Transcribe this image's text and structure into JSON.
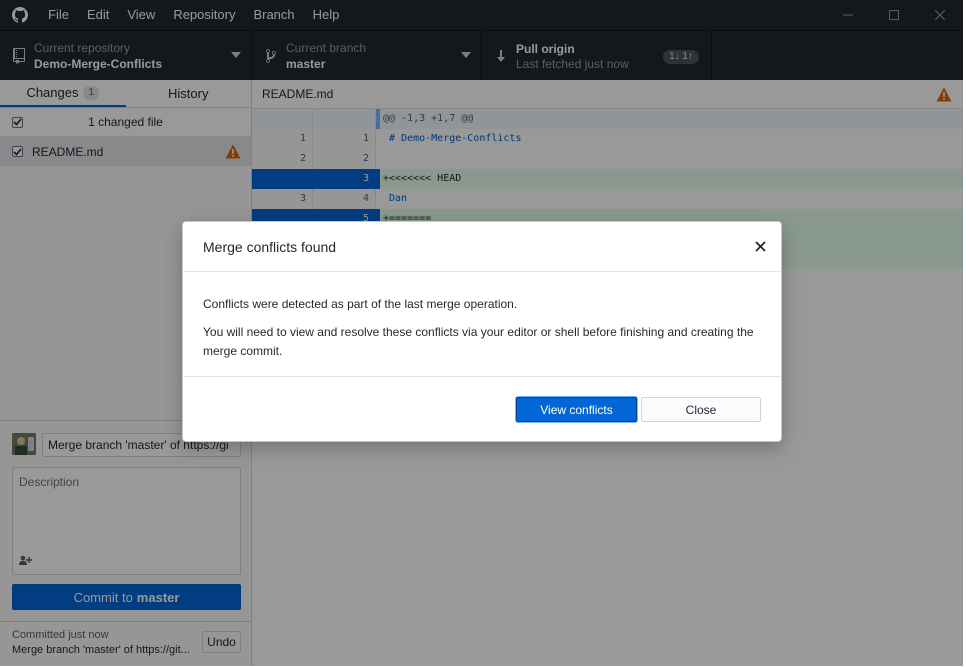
{
  "menu": {
    "items": [
      "File",
      "Edit",
      "View",
      "Repository",
      "Branch",
      "Help"
    ]
  },
  "toolbar": {
    "repository": {
      "label": "Current repository",
      "value": "Demo-Merge-Conflicts",
      "icon": "repo-icon"
    },
    "branch": {
      "label": "Current branch",
      "value": "master",
      "icon": "branch-icon"
    },
    "pull": {
      "label": "Pull origin",
      "value": "Last fetched just now",
      "icon": "arrow-down-icon",
      "badge": "1↓ 1↑"
    }
  },
  "sidebar": {
    "tabs": [
      {
        "label": "Changes",
        "count": "1",
        "active": true
      },
      {
        "label": "History",
        "active": false
      }
    ],
    "changed_header": "1 changed file",
    "files": [
      {
        "name": "README.md",
        "status": "conflicted"
      }
    ]
  },
  "commit": {
    "summary_value": "Merge branch 'master' of https://gi",
    "description_placeholder": "Description",
    "button_prefix": "Commit to",
    "button_branch": "master",
    "last_commit_label": "Committed just now",
    "last_commit_message": "Merge branch 'master' of https://git...",
    "undo_label": "Undo"
  },
  "diff": {
    "file_name": "README.md",
    "lines": [
      {
        "type": "hunk",
        "old": "",
        "new": "",
        "text": "@@ -1,3 +1,7 @@"
      },
      {
        "type": "context",
        "old": "1",
        "new": "1",
        "text": " # Demo-Merge-Conflicts"
      },
      {
        "type": "context",
        "old": "2",
        "new": "2",
        "text": ""
      },
      {
        "type": "add",
        "old": "",
        "new": "3",
        "text": "+<<<<<<< HEAD"
      },
      {
        "type": "context",
        "old": "3",
        "new": "4",
        "text": " Dan"
      },
      {
        "type": "add",
        "old": "",
        "new": "5",
        "text": "+======="
      }
    ]
  },
  "dialog": {
    "title": "Merge conflicts found",
    "paragraph1": "Conflicts were detected as part of the last merge operation.",
    "paragraph2": "You will need to view and resolve these conflicts via your editor or shell before finishing and creating the merge commit.",
    "primary_label": "View conflicts",
    "secondary_label": "Close"
  },
  "colors": {
    "chrome": "#24292e",
    "accent": "#0366d6",
    "warning": "#d86413",
    "addition": "#e6ffed"
  }
}
